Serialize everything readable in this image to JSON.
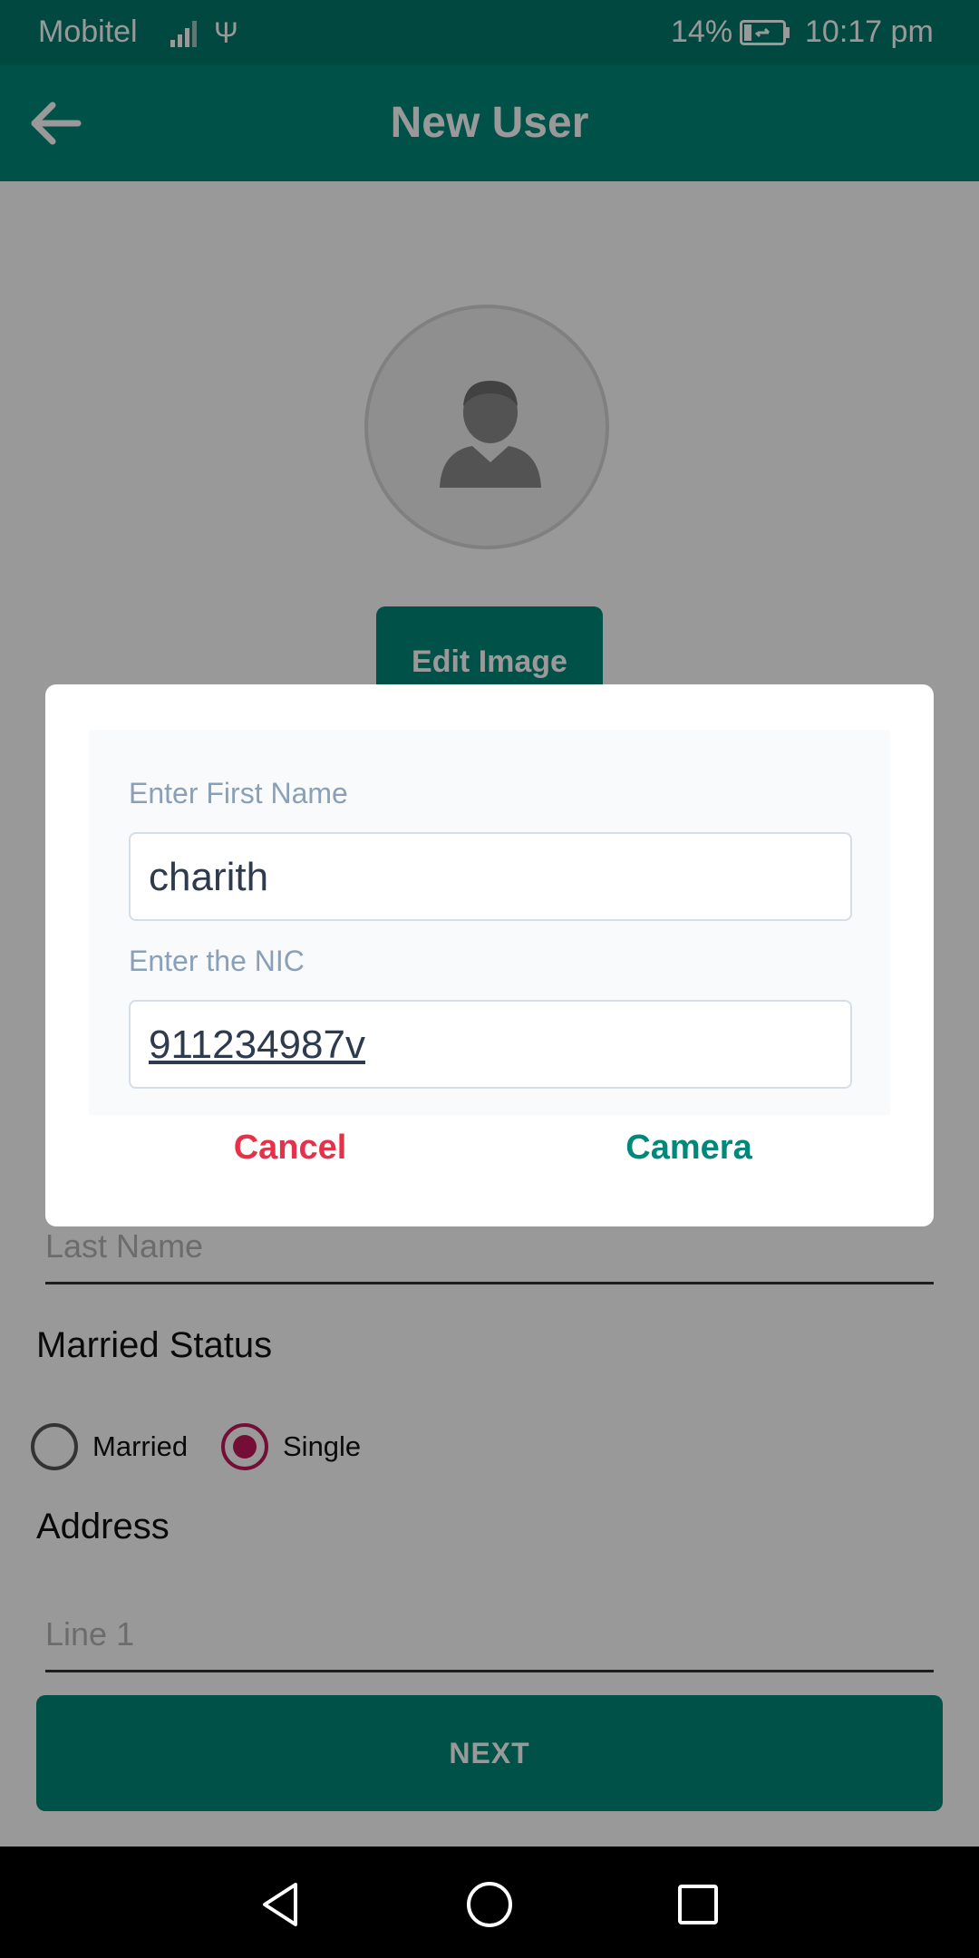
{
  "status_bar": {
    "carrier": "Mobitel",
    "battery_percent": "14%",
    "time": "10:17 pm",
    "icons": [
      "signal-icon",
      "usb-icon",
      "battery-charging-icon"
    ]
  },
  "app_bar": {
    "title": "New User",
    "back_icon": "arrow-left-icon"
  },
  "form": {
    "edit_image_label": "Edit Image",
    "last_name_placeholder": "Last Name",
    "married_status_title": "Married Status",
    "married_status_options": [
      {
        "label": "Married",
        "selected": false
      },
      {
        "label": "Single",
        "selected": true
      }
    ],
    "address_title": "Address",
    "line1_placeholder": "Line 1",
    "next_label": "NEXT"
  },
  "dialog": {
    "first_name_label": "Enter First Name",
    "first_name_value": "charith",
    "nic_label": "Enter the NIC",
    "nic_value": "911234987v",
    "cancel_label": "Cancel",
    "camera_label": "Camera"
  },
  "colors": {
    "primary": "#00897b",
    "primary_dark": "#00796b",
    "cancel": "#e5324a",
    "radio_selected": "#c2185b"
  }
}
